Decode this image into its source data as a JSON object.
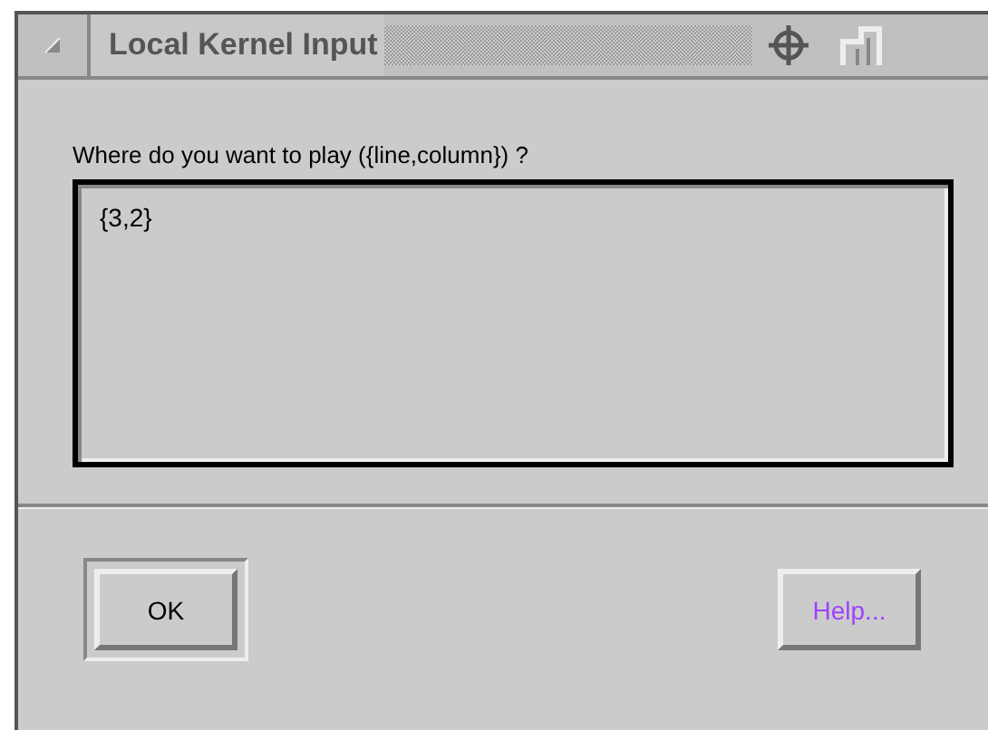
{
  "window": {
    "title": "Local Kernel Input"
  },
  "prompt": "Where do you want to play ({line,column}) ?",
  "input": {
    "value": "{3,2}"
  },
  "buttons": [
    {
      "label": "OK",
      "default": true,
      "kind": "plain"
    },
    {
      "label": "Help...",
      "default": false,
      "kind": "help"
    }
  ]
}
